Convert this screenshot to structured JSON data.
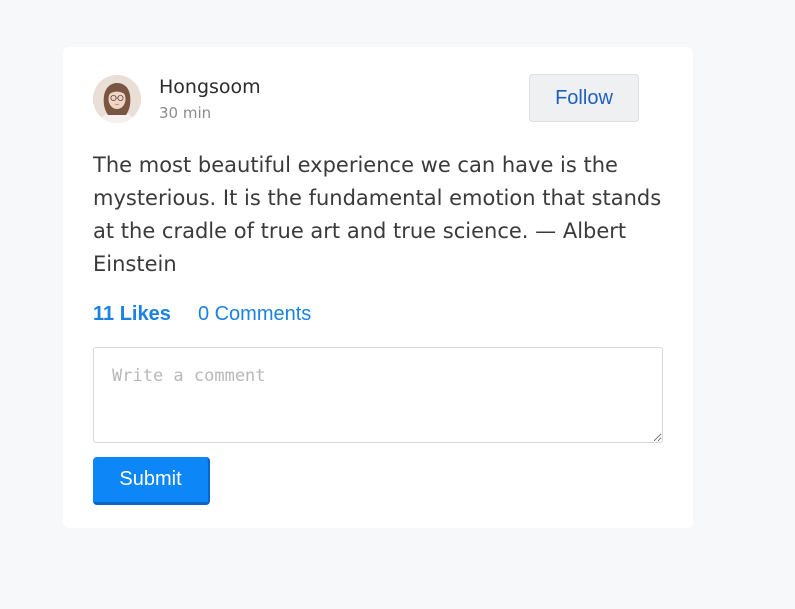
{
  "post": {
    "author": {
      "name": "Hongsoom",
      "avatar_icon": "user-avatar-photo"
    },
    "timestamp": "30 min",
    "follow_label": "Follow",
    "text": "The most beautiful experience we can have is the mysterious. It is the fundamental emotion that stands at the cradle of true art and true science. — Albert Einstein",
    "likes_label": "11 Likes",
    "comments_label": "0 Comments"
  },
  "comment_form": {
    "placeholder": "Write a comment",
    "value": "",
    "submit_label": "Submit"
  },
  "colors": {
    "page_background": "#f7f8fa",
    "card_background": "#ffffff",
    "link_blue": "#1a82e2",
    "submit_blue": "#0d86f7",
    "follow_text": "#1f5fbf"
  }
}
